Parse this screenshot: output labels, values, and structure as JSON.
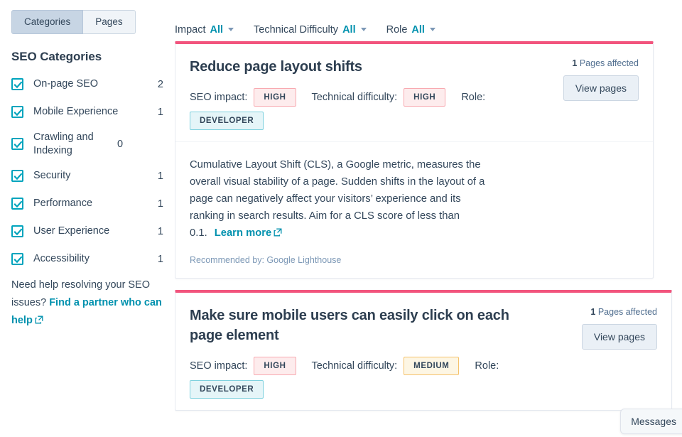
{
  "sidebar": {
    "tabs": [
      {
        "label": "Categories",
        "active": true
      },
      {
        "label": "Pages",
        "active": false
      }
    ],
    "title": "SEO Categories",
    "categories": [
      {
        "label": "On-page SEO",
        "count": "2",
        "checked": true
      },
      {
        "label": "Mobile Experience",
        "count": "1",
        "checked": true
      },
      {
        "label": "Crawling and Indexing",
        "count": "0",
        "checked": true
      },
      {
        "label": "Security",
        "count": "1",
        "checked": true
      },
      {
        "label": "Performance",
        "count": "1",
        "checked": true
      },
      {
        "label": "User Experience",
        "count": "1",
        "checked": true
      },
      {
        "label": "Accessibility",
        "count": "1",
        "checked": true
      }
    ],
    "help": {
      "text": "Need help resolving your SEO issues? ",
      "link_label": "Find a partner who can help"
    }
  },
  "filters": [
    {
      "label": "Impact",
      "value": "All"
    },
    {
      "label": "Technical Difficulty",
      "value": "All"
    },
    {
      "label": "Role",
      "value": "All"
    }
  ],
  "labels": {
    "seo_impact": "SEO impact:",
    "technical_difficulty": "Technical difficulty:",
    "role": "Role:",
    "view_pages": "View pages",
    "pages_affected_suffix": "Pages affected",
    "recommended_prefix": "Recommended by:",
    "learn_more": "Learn more"
  },
  "cards": [
    {
      "title": "Reduce page layout shifts",
      "pages_affected_count": "1",
      "impact": "HIGH",
      "difficulty": "HIGH",
      "role": "DEVELOPER",
      "description": "Cumulative Layout Shift (CLS), a Google metric, measures the overall visual stability of a page. Sudden shifts in the layout of a page can negatively affect your visitors’ experience and its ranking in search results. Aim for a CLS score of less than 0.1.",
      "recommended_by": "Google Lighthouse"
    },
    {
      "title": "Make sure mobile users can easily click on each page element",
      "pages_affected_count": "1",
      "impact": "HIGH",
      "difficulty": "MEDIUM",
      "role": "DEVELOPER"
    }
  ],
  "messages_widget": {
    "label": "Messages"
  },
  "colors": {
    "accent_bar": "#f2547d",
    "link": "#0091ae",
    "checkbox": "#00a4bd",
    "high": "#f8a9b0",
    "medium": "#f5c26b",
    "developer": "#7fd1de"
  }
}
